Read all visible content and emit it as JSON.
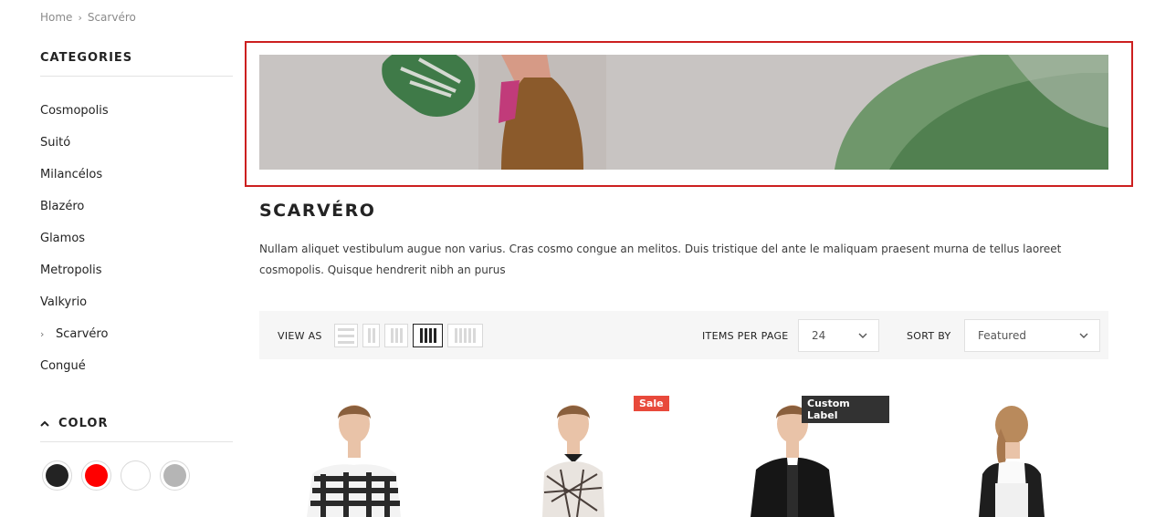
{
  "breadcrumb": {
    "home": "Home",
    "current": "Scarvéro"
  },
  "sidebar": {
    "categories_title": "CATEGORIES",
    "categories": [
      "Cosmopolis",
      "Suitó",
      "Milancélos",
      "Blazéro",
      "Glamos",
      "Metropolis",
      "Valkyrio",
      "Scarvéro",
      "Congué"
    ],
    "active_category": "Scarvéro",
    "color_title": "COLOR",
    "colors": [
      "#232323",
      "#ff0000",
      "#ffffff",
      "#b5b5b5"
    ]
  },
  "collection": {
    "title": "SCARVÉRO",
    "description": "Nullam aliquet vestibulum augue non varius. Cras cosmo congue an melitos. Duis tristique del ante le maliquam praesent murna de tellus laoreet cosmopolis. Quisque hendrerit nibh an purus"
  },
  "toolbar": {
    "view_as_label": "VIEW AS",
    "items_per_page_label": "ITEMS PER PAGE",
    "items_per_page_value": "24",
    "sort_by_label": "SORT BY",
    "sort_by_value": "Featured"
  },
  "products": [
    {
      "badge": ""
    },
    {
      "badge": "Sale"
    },
    {
      "badge": "Custom Label"
    },
    {
      "badge": ""
    }
  ],
  "accent_colors": {
    "highlight_frame": "#cc1f1f",
    "sale_badge": "#e8493b",
    "custom_badge": "#323232"
  }
}
